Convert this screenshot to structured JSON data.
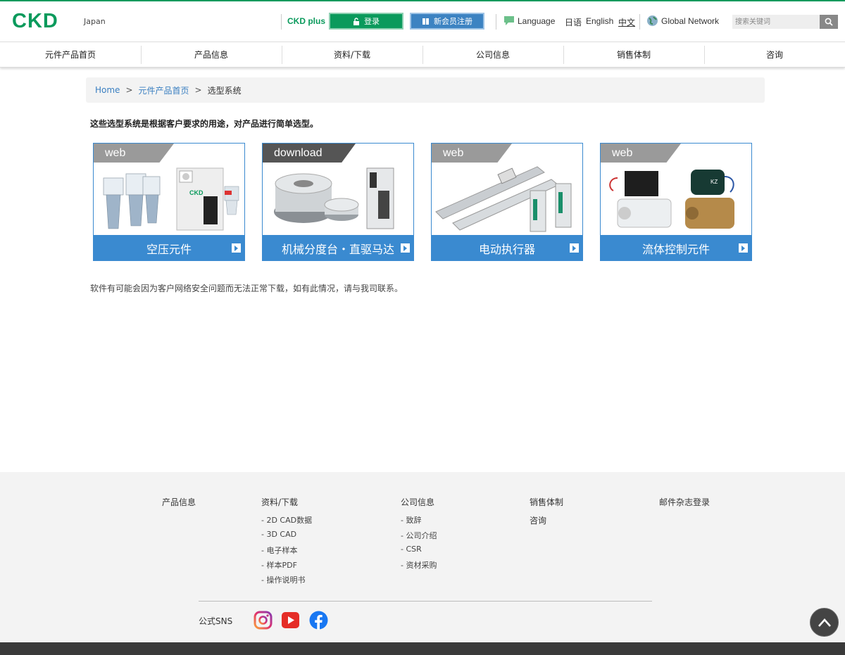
{
  "header": {
    "logo": "CKD",
    "region": "Japan",
    "ckd_plus": "CKD plus",
    "login_label": "登录",
    "register_label": "新会员注册",
    "language_label": "Language",
    "languages": [
      "日语",
      "English",
      "中文"
    ],
    "global_network": "Global Network",
    "search_placeholder": "搜索关键词"
  },
  "nav": {
    "items": [
      "元件产品首页",
      "产品信息",
      "资料/下载",
      "公司信息",
      "销售体制",
      "咨询"
    ]
  },
  "breadcrumb": {
    "home": "Home",
    "parent": "元件产品首页",
    "current": "选型系统",
    "sep": ">"
  },
  "main": {
    "intro": "这些选型系统是根据客户要求的用途，对产品进行简单选型。",
    "notice": "软件有可能会因为客户网络安全问题而无法正常下载，如有此情况，请与我司联系。",
    "cards": [
      {
        "tag": "web",
        "label": "空压元件"
      },
      {
        "tag": "download",
        "label": "机械分度台・直驱马达"
      },
      {
        "tag": "web",
        "label": "电动执行器"
      },
      {
        "tag": "web",
        "label": "流体控制元件"
      }
    ]
  },
  "footer": {
    "col1_title": "产品信息",
    "col2_title": "资料/下载",
    "col2_links": [
      "- 2D CAD数据",
      "- 3D CAD",
      "- 电子样本",
      "- 样本PDF",
      "- 操作说明书"
    ],
    "col3_title": "公司信息",
    "col3_links": [
      "- 致辞",
      "- 公司介绍",
      "- CSR",
      "- 资材采购"
    ],
    "col4_title": "销售体制",
    "col4_link": "咨询",
    "col5_title": "邮件杂志登录",
    "sns_label": "公式SNS"
  },
  "colors": {
    "brand_green": "#0a9a5c",
    "accent_blue": "#3a8ad0"
  },
  "icons": [
    "lock-icon",
    "book-icon",
    "speech-bubble-icon",
    "globe-icon",
    "search-icon",
    "arrow-right-icon",
    "instagram-icon",
    "youtube-icon",
    "facebook-icon",
    "chevron-up-icon"
  ]
}
